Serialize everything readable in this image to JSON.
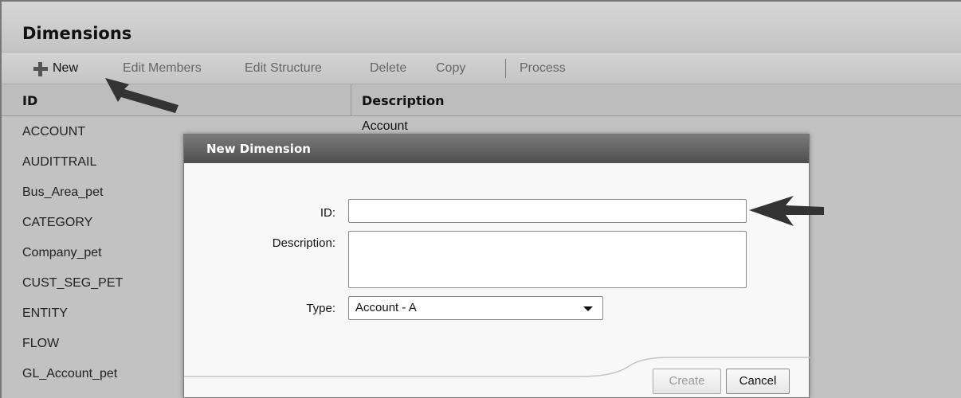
{
  "panel": {
    "title": "Dimensions"
  },
  "toolbar": {
    "new_label": "New",
    "edit_members_label": "Edit Members",
    "edit_structure_label": "Edit Structure",
    "delete_label": "Delete",
    "copy_label": "Copy",
    "process_label": "Process"
  },
  "grid": {
    "columns": [
      "ID",
      "Description"
    ],
    "rows": [
      {
        "id": "ACCOUNT",
        "description": "Account"
      },
      {
        "id": "AUDITTRAIL",
        "description": ""
      },
      {
        "id": "Bus_Area_pet",
        "description": ""
      },
      {
        "id": "CATEGORY",
        "description": ""
      },
      {
        "id": "Company_pet",
        "description": ""
      },
      {
        "id": "CUST_SEG_PET",
        "description": ""
      },
      {
        "id": "ENTITY",
        "description": ""
      },
      {
        "id": "FLOW",
        "description": ""
      },
      {
        "id": "GL_Account_pet",
        "description": ""
      }
    ]
  },
  "dialog": {
    "title": "New Dimension",
    "id_label": "ID:",
    "id_value": "",
    "description_label": "Description:",
    "description_value": "",
    "type_label": "Type:",
    "type_value": "Account - A",
    "create_label": "Create",
    "cancel_label": "Cancel"
  }
}
